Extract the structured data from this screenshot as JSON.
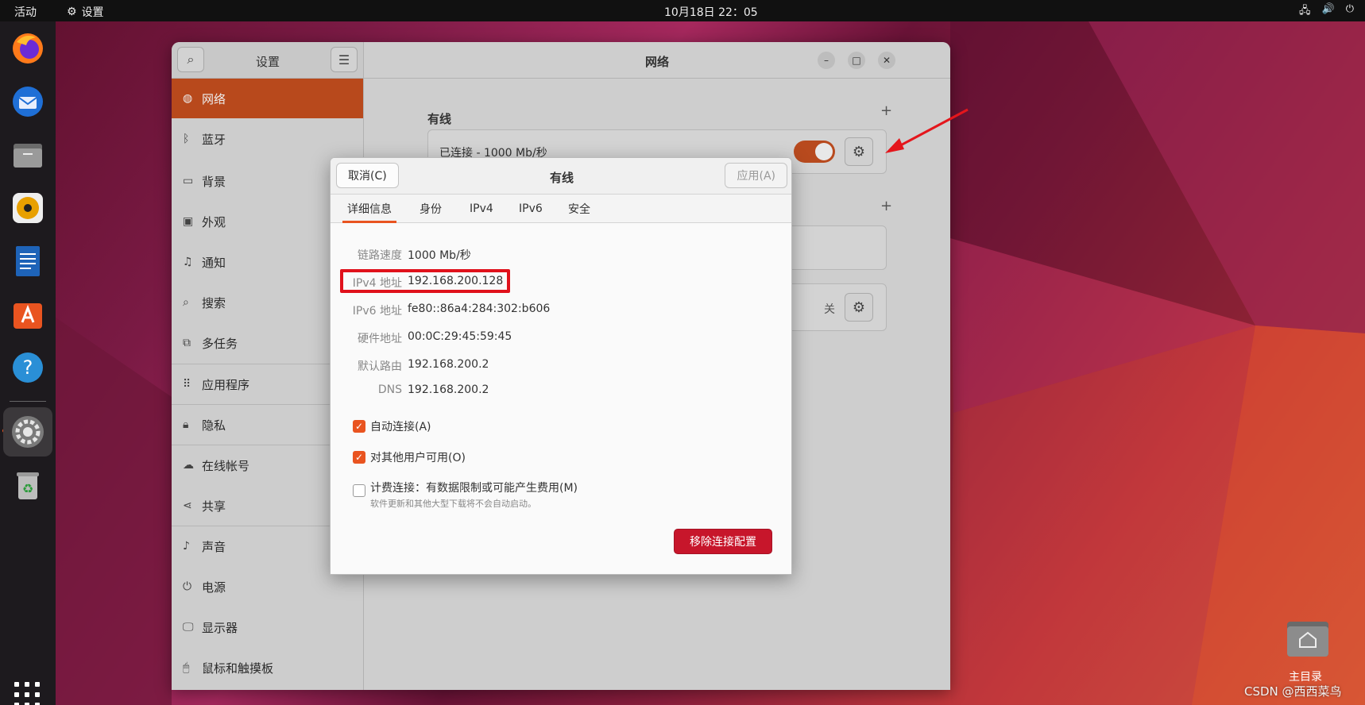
{
  "topbar": {
    "activities": "活动",
    "app_name": "设置",
    "clock": "10月18日  22：05"
  },
  "dock": {
    "items": [
      "firefox-icon",
      "thunderbird-icon",
      "files-icon",
      "rhythmbox-icon",
      "writer-icon",
      "app-center-icon",
      "help-icon",
      "settings-icon",
      "trash-icon"
    ]
  },
  "settings": {
    "sidebar_title": "设置",
    "main_title": "网络",
    "sidebar_items": [
      {
        "label": "网络",
        "icon": "network-icon"
      },
      {
        "label": "蓝牙",
        "icon": "bluetooth-icon"
      },
      {
        "label": "背景",
        "icon": "background-icon"
      },
      {
        "label": "外观",
        "icon": "appearance-icon"
      },
      {
        "label": "通知",
        "icon": "bell-icon"
      },
      {
        "label": "搜索",
        "icon": "search-icon"
      },
      {
        "label": "多任务",
        "icon": "multitask-icon"
      },
      {
        "label": "应用程序",
        "icon": "apps-icon"
      },
      {
        "label": "隐私",
        "icon": "lock-icon"
      },
      {
        "label": "在线帐号",
        "icon": "cloud-icon"
      },
      {
        "label": "共享",
        "icon": "share-icon"
      },
      {
        "label": "声音",
        "icon": "music-icon"
      },
      {
        "label": "电源",
        "icon": "power-icon"
      },
      {
        "label": "显示器",
        "icon": "display-icon"
      },
      {
        "label": "鼠标和触摸板",
        "icon": "mouse-icon"
      }
    ],
    "wired_section": "有线",
    "wired_status": "已连接 - 1000 Mb/秒",
    "proxy_state": "关"
  },
  "dialog": {
    "title": "有线",
    "cancel": "取消(C)",
    "apply": "应用(A)",
    "tabs": [
      "详细信息",
      "身份",
      "IPv4",
      "IPv6",
      "安全"
    ],
    "details": [
      {
        "key": "链路速度",
        "value": "1000 Mb/秒"
      },
      {
        "key": "IPv4 地址",
        "value": "192.168.200.128"
      },
      {
        "key": "IPv6 地址",
        "value": "fe80::86a4:284:302:b606"
      },
      {
        "key": "硬件地址",
        "value": "00:0C:29:45:59:45"
      },
      {
        "key": "默认路由",
        "value": "192.168.200.2"
      },
      {
        "key": "DNS",
        "value": "192.168.200.2"
      }
    ],
    "auto_connect": "自动连接(A)",
    "all_users": "对其他用户可用(O)",
    "metered": "计费连接：有数据限制或可能产生费用(M)",
    "metered_hint": "软件更新和其他大型下载将不会自动启动。",
    "remove": "移除连接配置"
  },
  "desktop": {
    "home_label": "主目录",
    "watermark": "CSDN @西西菜鸟"
  },
  "colors": {
    "accent": "#e95420",
    "remove": "#c7162b",
    "highlight": "#e0111b"
  }
}
